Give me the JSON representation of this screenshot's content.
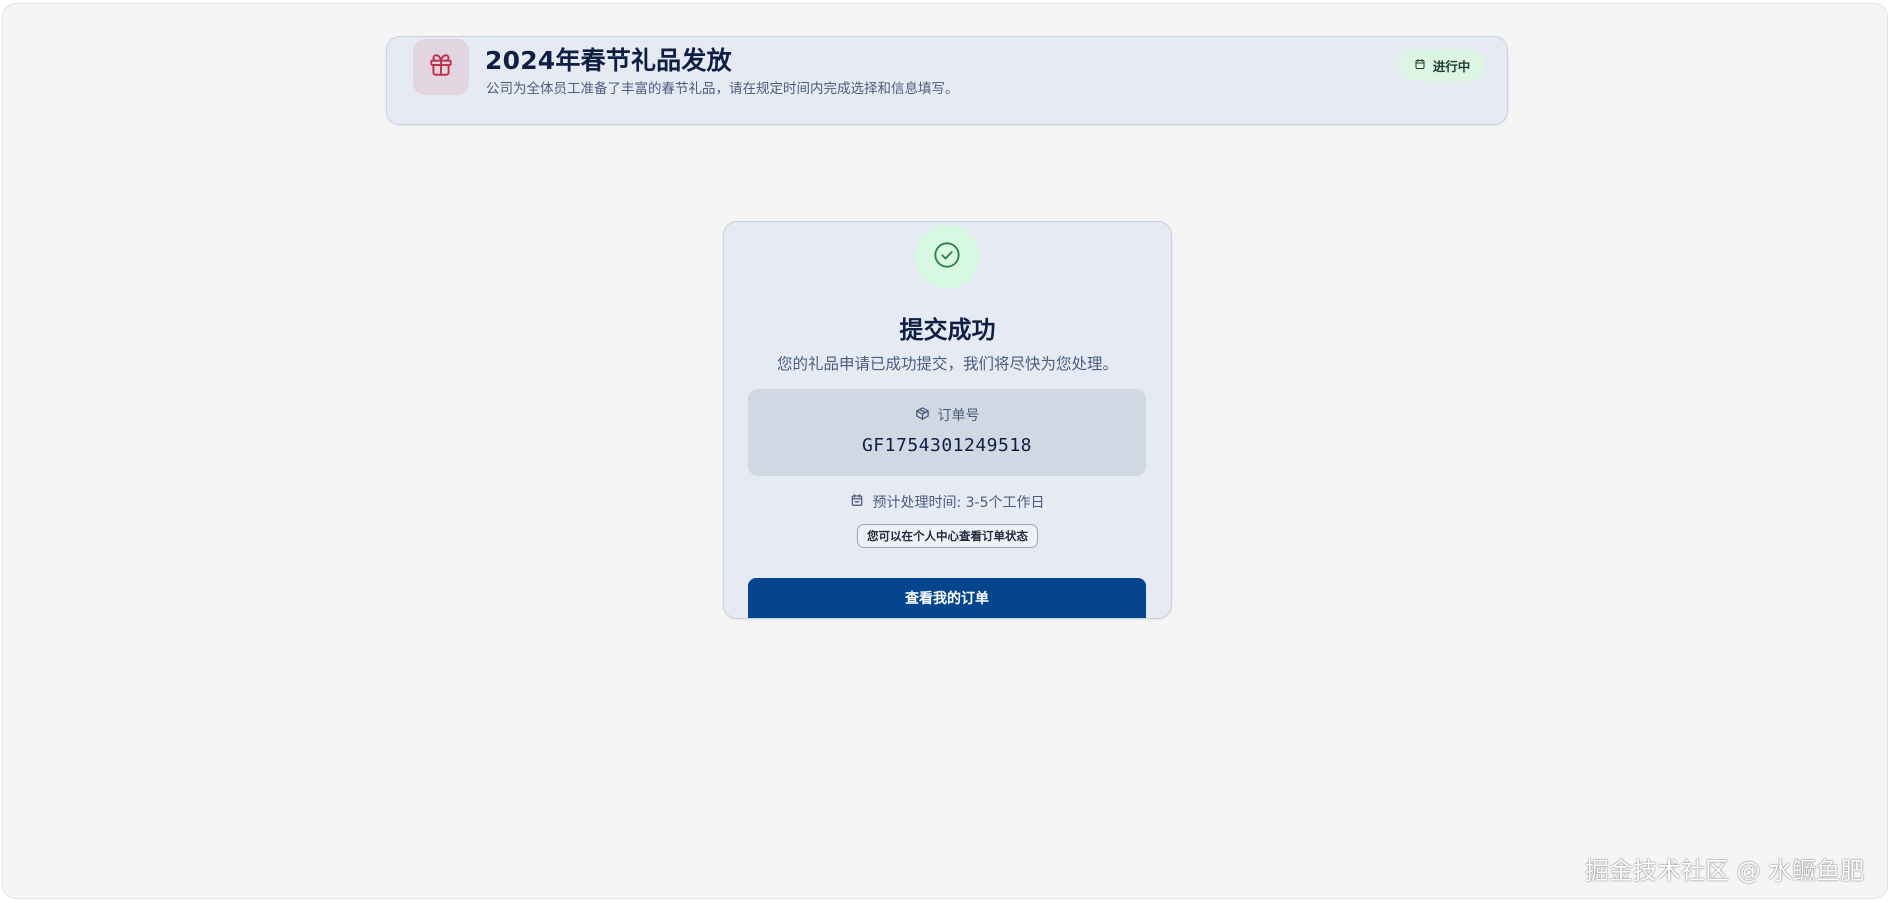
{
  "header": {
    "title": "2024年春节礼品发放",
    "subtitle": "公司为全体员工准备了丰富的春节礼品，请在规定时间内完成选择和信息填写。",
    "status": "进行中",
    "gift_icon": "gift-icon",
    "status_icon": "calendar-icon"
  },
  "success": {
    "icon": "check-circle-icon",
    "title": "提交成功",
    "message": "您的礼品申请已成功提交，我们将尽快为您处理。",
    "order_label": "订单号",
    "order_icon": "package-icon",
    "order_number": "GF1754301249518",
    "eta": "预计处理时间: 3-5个工作日",
    "eta_icon": "calendar-icon",
    "hint": "您可以在个人中心查看订单状态",
    "button_label": "查看我的订单"
  },
  "watermark": "掘金技术社区 @ 水鳜鱼肥",
  "colors": {
    "accent": "#04458e",
    "success_bg": "#d7f8e1",
    "success_icon": "#2e7d4f",
    "gift_icon": "#c0314e",
    "card_bg": "#e6ebf3"
  }
}
